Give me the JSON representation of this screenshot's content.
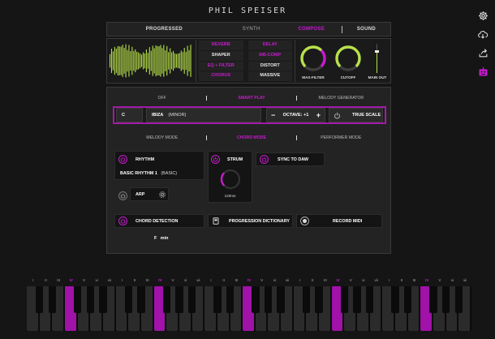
{
  "brand": "PHIL SPEISER",
  "colors": {
    "accent": "#c81ad0",
    "background": "#151515",
    "panel": "#232323"
  },
  "side_icons": [
    "gear-icon",
    "cloud-download-icon",
    "share-icon",
    "robot-icon"
  ],
  "tabs": {
    "progressed": "PROGRESSED",
    "synth": "SYNTH",
    "compose": "COMPOSE",
    "sound": "SOUND",
    "active": "COMPOSE"
  },
  "effects": [
    {
      "label": "REVERB",
      "on": true
    },
    {
      "label": "DELAY",
      "on": true
    },
    {
      "label": "SHAPER",
      "on": false
    },
    {
      "label": "MB-COMP",
      "on": true
    },
    {
      "label": "EQ + FILTER",
      "on": true
    },
    {
      "label": "DISTORT",
      "on": false
    },
    {
      "label": "CHORUS",
      "on": true
    },
    {
      "label": "MASSIVE",
      "on": false
    }
  ],
  "knobs": {
    "max_filter": "MAX-FILTER",
    "cutoff": "CUTOFF",
    "main_out": "MAIN OUT"
  },
  "mode_tabs": {
    "off": "OFF",
    "smart_play": "SMART PLAY",
    "melody_generator": "MELODY GENERATOR"
  },
  "scale": {
    "key": "C",
    "scale_name": "IBIZA",
    "scale_mode": "(MINOR)",
    "octave_minus": "−",
    "octave_label": "OCTAVE: +1",
    "octave_plus": "+",
    "true_scale": "TRUE SCALE"
  },
  "play_modes": {
    "melody": "MELODY MODE",
    "chord": "CHORD MODE",
    "performer": "PERFORMER MODE"
  },
  "rhythm": {
    "title": "RHYTHM",
    "preset": "BASIC RHYTHM 1",
    "preset_type": "(BASIC)"
  },
  "arp": {
    "label": "ARP"
  },
  "strum": {
    "title": "STRUM",
    "value": "120ms"
  },
  "sync": {
    "label": "SYNC TO DAW"
  },
  "chord_detection": {
    "label": "CHORD DETECTION",
    "chord": "F",
    "quality": "min"
  },
  "progression_dictionary": {
    "label": "PROGRESSION DICTIONARY"
  },
  "record_midi": {
    "label": "RECORD MIDI"
  },
  "keyboard": {
    "numerals": [
      "I",
      "II",
      "III",
      "IV",
      "V",
      "vi",
      "vii",
      "I",
      "II",
      "III",
      "IV",
      "V",
      "vi",
      "vii",
      "I",
      "II",
      "III",
      "IV",
      "V",
      "vi",
      "vii",
      "I",
      "II",
      "III",
      "IV",
      "V",
      "vi",
      "vii",
      "I",
      "II",
      "III",
      "IV",
      "V",
      "vi",
      "vii"
    ],
    "highlighted_numeral": "IV",
    "white_key_count": 35,
    "highlighted_white_keys": [
      3,
      10,
      17,
      24,
      31
    ]
  }
}
